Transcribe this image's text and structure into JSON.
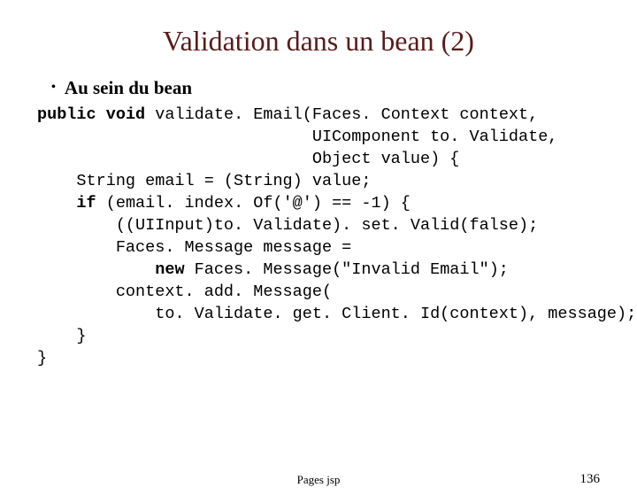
{
  "title": "Validation dans un bean (2)",
  "bullet": "Au sein du bean",
  "code": {
    "kw_public": "public",
    "kw_void": "void",
    "sig_rest": " validate. Email(Faces. Context context,",
    "arg2": "                            UIComponent to. Validate,",
    "arg3": "                            Object value) {",
    "line4": "    String email = (String) value;",
    "kw_if": "if",
    "if_rest": " (email. index. Of('@') == -1) {",
    "line6": "        ((UIInput)to. Validate). set. Valid(false);",
    "line7": "        Faces. Message message =",
    "kw_new": "new",
    "new_rest": " Faces. Message(\"Invalid Email\");",
    "line9": "        context. add. Message(",
    "line10": "            to. Validate. get. Client. Id(context), message);",
    "line11": "    }",
    "line12": "}"
  },
  "footer_center": "Pages jsp",
  "page_number": "136"
}
